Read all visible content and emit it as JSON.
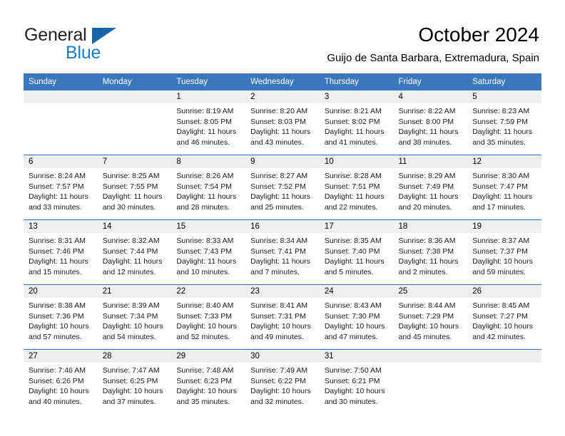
{
  "brand": {
    "name_part1": "General",
    "name_part2": "Blue",
    "triangle_color": "#1565a8",
    "blue_text_color": "#1a7bc4"
  },
  "header": {
    "title": "October 2024",
    "subtitle": "Guijo de Santa Barbara, Extremadura, Spain"
  },
  "theme": {
    "header_row_bg": "#3b77bc",
    "header_row_text": "#ffffff",
    "row_divider": "#2f6fb5",
    "daynum_band_bg": "#efefef",
    "page_bg": "#ffffff"
  },
  "weekday_headers": [
    "Sunday",
    "Monday",
    "Tuesday",
    "Wednesday",
    "Thursday",
    "Friday",
    "Saturday"
  ],
  "weeks": [
    [
      {
        "day": "",
        "empty": true,
        "sunrise": "",
        "sunset": "",
        "daylight_line1": "",
        "daylight_line2": ""
      },
      {
        "day": "",
        "empty": true,
        "sunrise": "",
        "sunset": "",
        "daylight_line1": "",
        "daylight_line2": ""
      },
      {
        "day": "1",
        "empty": false,
        "sunrise": "Sunrise: 8:19 AM",
        "sunset": "Sunset: 8:05 PM",
        "daylight_line1": "Daylight: 11 hours",
        "daylight_line2": "and 46 minutes."
      },
      {
        "day": "2",
        "empty": false,
        "sunrise": "Sunrise: 8:20 AM",
        "sunset": "Sunset: 8:03 PM",
        "daylight_line1": "Daylight: 11 hours",
        "daylight_line2": "and 43 minutes."
      },
      {
        "day": "3",
        "empty": false,
        "sunrise": "Sunrise: 8:21 AM",
        "sunset": "Sunset: 8:02 PM",
        "daylight_line1": "Daylight: 11 hours",
        "daylight_line2": "and 41 minutes."
      },
      {
        "day": "4",
        "empty": false,
        "sunrise": "Sunrise: 8:22 AM",
        "sunset": "Sunset: 8:00 PM",
        "daylight_line1": "Daylight: 11 hours",
        "daylight_line2": "and 38 minutes."
      },
      {
        "day": "5",
        "empty": false,
        "sunrise": "Sunrise: 8:23 AM",
        "sunset": "Sunset: 7:59 PM",
        "daylight_line1": "Daylight: 11 hours",
        "daylight_line2": "and 35 minutes."
      }
    ],
    [
      {
        "day": "6",
        "empty": false,
        "sunrise": "Sunrise: 8:24 AM",
        "sunset": "Sunset: 7:57 PM",
        "daylight_line1": "Daylight: 11 hours",
        "daylight_line2": "and 33 minutes."
      },
      {
        "day": "7",
        "empty": false,
        "sunrise": "Sunrise: 8:25 AM",
        "sunset": "Sunset: 7:55 PM",
        "daylight_line1": "Daylight: 11 hours",
        "daylight_line2": "and 30 minutes."
      },
      {
        "day": "8",
        "empty": false,
        "sunrise": "Sunrise: 8:26 AM",
        "sunset": "Sunset: 7:54 PM",
        "daylight_line1": "Daylight: 11 hours",
        "daylight_line2": "and 28 minutes."
      },
      {
        "day": "9",
        "empty": false,
        "sunrise": "Sunrise: 8:27 AM",
        "sunset": "Sunset: 7:52 PM",
        "daylight_line1": "Daylight: 11 hours",
        "daylight_line2": "and 25 minutes."
      },
      {
        "day": "10",
        "empty": false,
        "sunrise": "Sunrise: 8:28 AM",
        "sunset": "Sunset: 7:51 PM",
        "daylight_line1": "Daylight: 11 hours",
        "daylight_line2": "and 22 minutes."
      },
      {
        "day": "11",
        "empty": false,
        "sunrise": "Sunrise: 8:29 AM",
        "sunset": "Sunset: 7:49 PM",
        "daylight_line1": "Daylight: 11 hours",
        "daylight_line2": "and 20 minutes."
      },
      {
        "day": "12",
        "empty": false,
        "sunrise": "Sunrise: 8:30 AM",
        "sunset": "Sunset: 7:47 PM",
        "daylight_line1": "Daylight: 11 hours",
        "daylight_line2": "and 17 minutes."
      }
    ],
    [
      {
        "day": "13",
        "empty": false,
        "sunrise": "Sunrise: 8:31 AM",
        "sunset": "Sunset: 7:46 PM",
        "daylight_line1": "Daylight: 11 hours",
        "daylight_line2": "and 15 minutes."
      },
      {
        "day": "14",
        "empty": false,
        "sunrise": "Sunrise: 8:32 AM",
        "sunset": "Sunset: 7:44 PM",
        "daylight_line1": "Daylight: 11 hours",
        "daylight_line2": "and 12 minutes."
      },
      {
        "day": "15",
        "empty": false,
        "sunrise": "Sunrise: 8:33 AM",
        "sunset": "Sunset: 7:43 PM",
        "daylight_line1": "Daylight: 11 hours",
        "daylight_line2": "and 10 minutes."
      },
      {
        "day": "16",
        "empty": false,
        "sunrise": "Sunrise: 8:34 AM",
        "sunset": "Sunset: 7:41 PM",
        "daylight_line1": "Daylight: 11 hours",
        "daylight_line2": "and 7 minutes."
      },
      {
        "day": "17",
        "empty": false,
        "sunrise": "Sunrise: 8:35 AM",
        "sunset": "Sunset: 7:40 PM",
        "daylight_line1": "Daylight: 11 hours",
        "daylight_line2": "and 5 minutes."
      },
      {
        "day": "18",
        "empty": false,
        "sunrise": "Sunrise: 8:36 AM",
        "sunset": "Sunset: 7:38 PM",
        "daylight_line1": "Daylight: 11 hours",
        "daylight_line2": "and 2 minutes."
      },
      {
        "day": "19",
        "empty": false,
        "sunrise": "Sunrise: 8:37 AM",
        "sunset": "Sunset: 7:37 PM",
        "daylight_line1": "Daylight: 10 hours",
        "daylight_line2": "and 59 minutes."
      }
    ],
    [
      {
        "day": "20",
        "empty": false,
        "sunrise": "Sunrise: 8:38 AM",
        "sunset": "Sunset: 7:36 PM",
        "daylight_line1": "Daylight: 10 hours",
        "daylight_line2": "and 57 minutes."
      },
      {
        "day": "21",
        "empty": false,
        "sunrise": "Sunrise: 8:39 AM",
        "sunset": "Sunset: 7:34 PM",
        "daylight_line1": "Daylight: 10 hours",
        "daylight_line2": "and 54 minutes."
      },
      {
        "day": "22",
        "empty": false,
        "sunrise": "Sunrise: 8:40 AM",
        "sunset": "Sunset: 7:33 PM",
        "daylight_line1": "Daylight: 10 hours",
        "daylight_line2": "and 52 minutes."
      },
      {
        "day": "23",
        "empty": false,
        "sunrise": "Sunrise: 8:41 AM",
        "sunset": "Sunset: 7:31 PM",
        "daylight_line1": "Daylight: 10 hours",
        "daylight_line2": "and 49 minutes."
      },
      {
        "day": "24",
        "empty": false,
        "sunrise": "Sunrise: 8:43 AM",
        "sunset": "Sunset: 7:30 PM",
        "daylight_line1": "Daylight: 10 hours",
        "daylight_line2": "and 47 minutes."
      },
      {
        "day": "25",
        "empty": false,
        "sunrise": "Sunrise: 8:44 AM",
        "sunset": "Sunset: 7:29 PM",
        "daylight_line1": "Daylight: 10 hours",
        "daylight_line2": "and 45 minutes."
      },
      {
        "day": "26",
        "empty": false,
        "sunrise": "Sunrise: 8:45 AM",
        "sunset": "Sunset: 7:27 PM",
        "daylight_line1": "Daylight: 10 hours",
        "daylight_line2": "and 42 minutes."
      }
    ],
    [
      {
        "day": "27",
        "empty": false,
        "sunrise": "Sunrise: 7:46 AM",
        "sunset": "Sunset: 6:26 PM",
        "daylight_line1": "Daylight: 10 hours",
        "daylight_line2": "and 40 minutes."
      },
      {
        "day": "28",
        "empty": false,
        "sunrise": "Sunrise: 7:47 AM",
        "sunset": "Sunset: 6:25 PM",
        "daylight_line1": "Daylight: 10 hours",
        "daylight_line2": "and 37 minutes."
      },
      {
        "day": "29",
        "empty": false,
        "sunrise": "Sunrise: 7:48 AM",
        "sunset": "Sunset: 6:23 PM",
        "daylight_line1": "Daylight: 10 hours",
        "daylight_line2": "and 35 minutes."
      },
      {
        "day": "30",
        "empty": false,
        "sunrise": "Sunrise: 7:49 AM",
        "sunset": "Sunset: 6:22 PM",
        "daylight_line1": "Daylight: 10 hours",
        "daylight_line2": "and 32 minutes."
      },
      {
        "day": "31",
        "empty": false,
        "sunrise": "Sunrise: 7:50 AM",
        "sunset": "Sunset: 6:21 PM",
        "daylight_line1": "Daylight: 10 hours",
        "daylight_line2": "and 30 minutes."
      },
      {
        "day": "",
        "empty": true,
        "sunrise": "",
        "sunset": "",
        "daylight_line1": "",
        "daylight_line2": ""
      },
      {
        "day": "",
        "empty": true,
        "sunrise": "",
        "sunset": "",
        "daylight_line1": "",
        "daylight_line2": ""
      }
    ]
  ]
}
